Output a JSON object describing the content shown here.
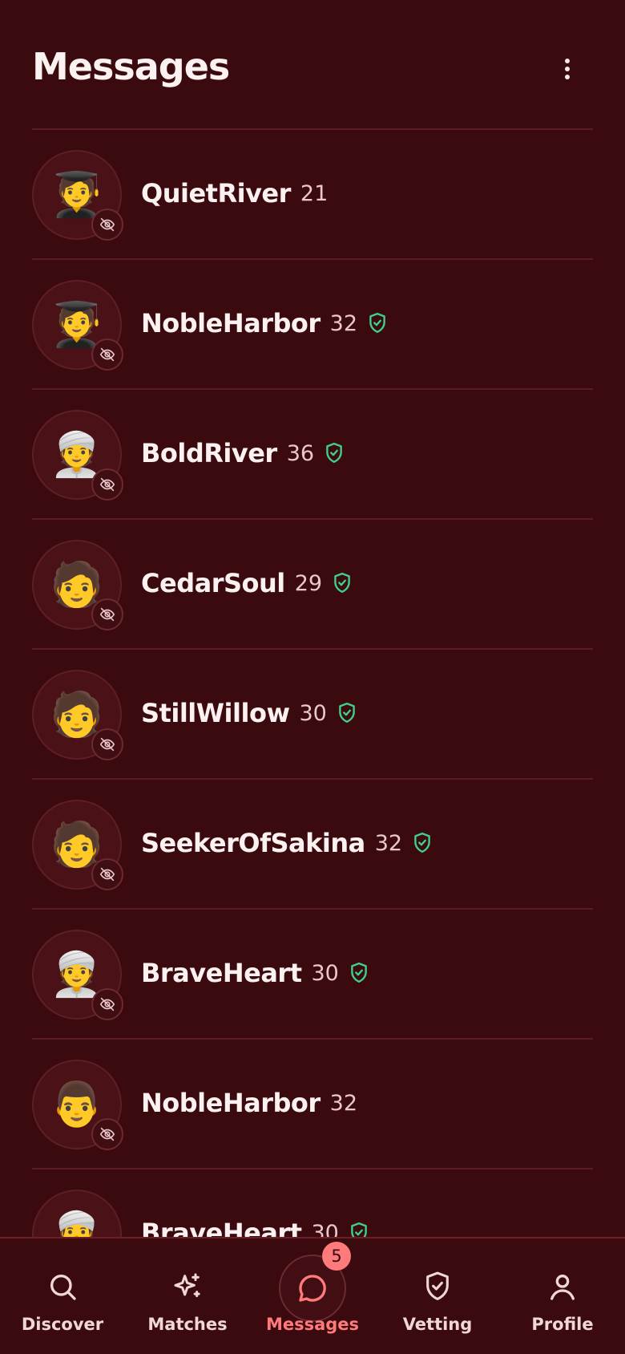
{
  "header": {
    "title": "Messages",
    "menu_icon": "more-vertical-icon"
  },
  "colors": {
    "background": "#3a0a0e",
    "accent": "#ff7a7a",
    "verified": "#3fd08e"
  },
  "conversations": [
    {
      "name": "QuietRiver",
      "age": "21",
      "avatar": "🧑‍🎓",
      "verified": false
    },
    {
      "name": "NobleHarbor",
      "age": "32",
      "avatar": "🧑‍🎓",
      "verified": true
    },
    {
      "name": "BoldRiver",
      "age": "36",
      "avatar": "👳",
      "verified": true
    },
    {
      "name": "CedarSoul",
      "age": "29",
      "avatar": "🧑",
      "verified": true
    },
    {
      "name": "StillWillow",
      "age": "30",
      "avatar": "🧑",
      "verified": true
    },
    {
      "name": "SeekerOfSakina",
      "age": "32",
      "avatar": "🧑",
      "verified": true
    },
    {
      "name": "BraveHeart",
      "age": "30",
      "avatar": "👳",
      "verified": true
    },
    {
      "name": "NobleHarbor",
      "age": "32",
      "avatar": "👨",
      "verified": false
    },
    {
      "name": "BraveHeart",
      "age": "30",
      "avatar": "👳",
      "verified": true
    }
  ],
  "nav": {
    "items": [
      {
        "label": "Discover",
        "icon": "search-icon"
      },
      {
        "label": "Matches",
        "icon": "sparkles-icon"
      },
      {
        "label": "Messages",
        "icon": "chat-bubble-icon",
        "badge": "5"
      },
      {
        "label": "Vetting",
        "icon": "shield-check-icon"
      },
      {
        "label": "Profile",
        "icon": "user-icon"
      }
    ],
    "active_index": 2
  }
}
